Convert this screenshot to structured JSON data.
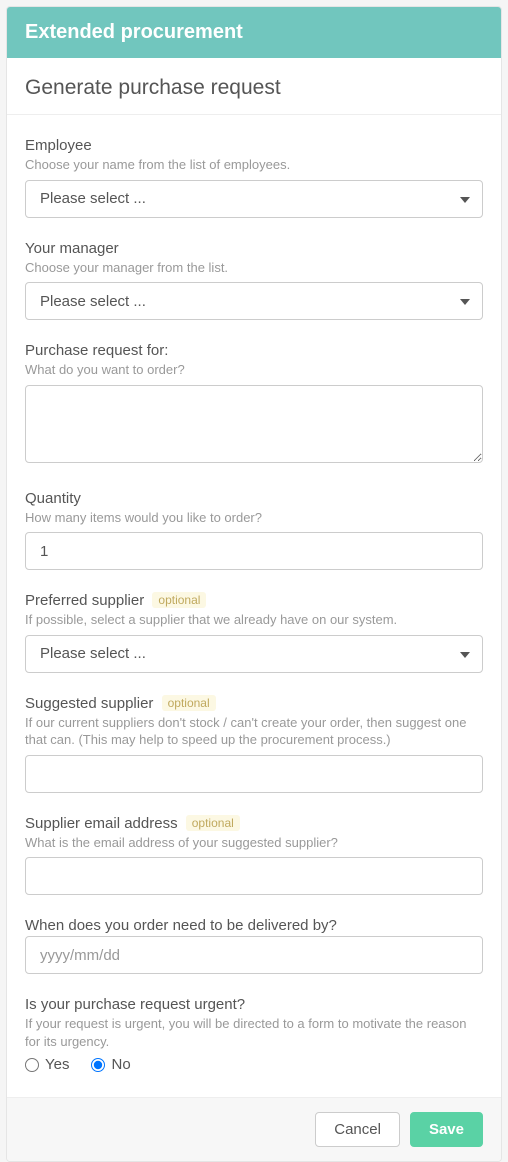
{
  "header": {
    "title": "Extended procurement"
  },
  "page": {
    "title": "Generate purchase request"
  },
  "badges": {
    "optional": "optional"
  },
  "select": {
    "placeholder": "Please select ..."
  },
  "employee": {
    "label": "Employee",
    "hint": "Choose your name from the list of employees."
  },
  "manager": {
    "label": "Your manager",
    "hint": "Choose your manager from the list."
  },
  "request_for": {
    "label": "Purchase request for:",
    "hint": "What do you want to order?",
    "value": ""
  },
  "quantity": {
    "label": "Quantity",
    "hint": "How many items would you like to order?",
    "value": "1"
  },
  "preferred_supplier": {
    "label": "Preferred supplier",
    "hint": "If possible, select a supplier that we already have on our system."
  },
  "suggested_supplier": {
    "label": "Suggested supplier",
    "hint": "If our current suppliers don't stock / can't create your order, then suggest one that can. (This may help to speed up the procurement process.)",
    "value": ""
  },
  "supplier_email": {
    "label": "Supplier email address",
    "hint": "What is the email address of your suggested supplier?",
    "value": ""
  },
  "delivery_date": {
    "label": "When does you order need to be delivered by?",
    "placeholder": "yyyy/mm/dd",
    "value": ""
  },
  "urgent": {
    "label": "Is your purchase request urgent?",
    "hint": "If your request is urgent, you will be directed to a form to motivate the reason for its urgency.",
    "options": {
      "yes": "Yes",
      "no": "No"
    },
    "selected": "no"
  },
  "footer": {
    "cancel": "Cancel",
    "save": "Save"
  }
}
